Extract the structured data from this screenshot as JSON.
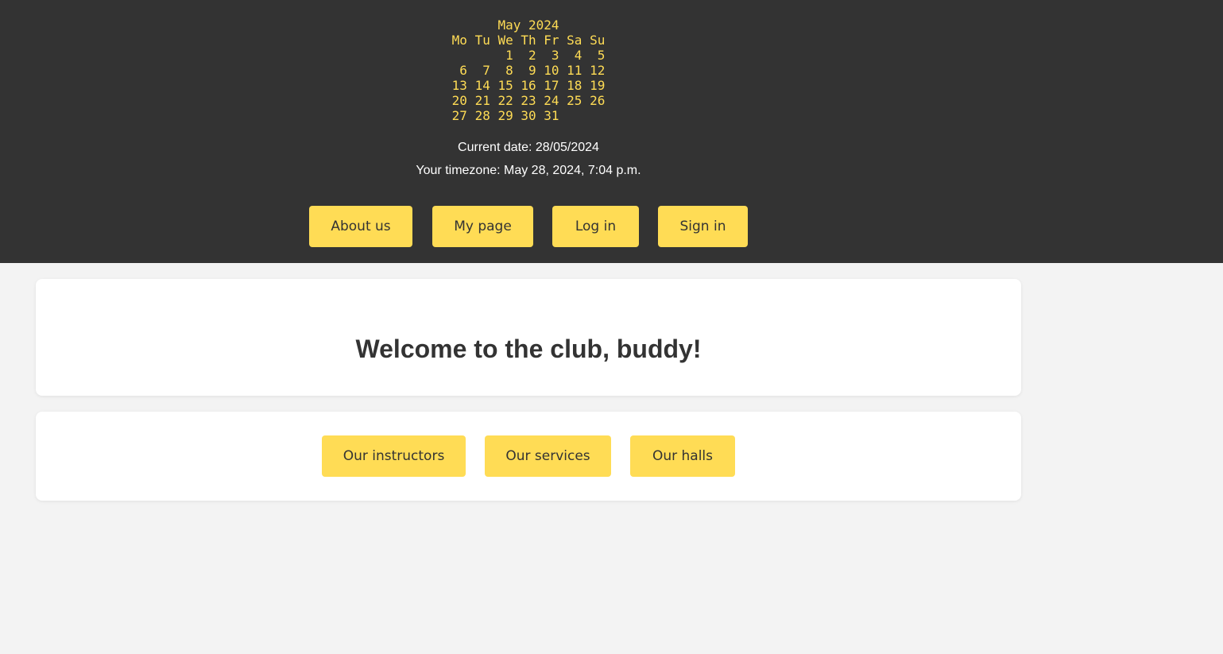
{
  "calendar": {
    "title": "May 2024",
    "weekday_header": "Mo Tu We Th Fr Sa Su",
    "weeks": [
      "       1  2  3  4  5",
      " 6  7  8  9 10 11 12",
      "13 14 15 16 17 18 19",
      "20 21 22 23 24 25 26",
      "27 28 29 30 31"
    ]
  },
  "info": {
    "current_date": "Current date: 28/05/2024",
    "timezone": "Your timezone: May 28, 2024, 7:04 p.m."
  },
  "nav": {
    "about_us": "About us",
    "my_page": "My page",
    "log_in": "Log in",
    "sign_in": "Sign in"
  },
  "welcome": {
    "title": "Welcome to the club, buddy!"
  },
  "links": {
    "instructors": "Our instructors",
    "services": "Our services",
    "halls": "Our halls"
  },
  "colors": {
    "header_bg": "#333333",
    "accent_yellow": "#ffdc55",
    "page_bg": "#f3f3f3",
    "card_bg": "#ffffff",
    "text_dark": "#333333"
  }
}
